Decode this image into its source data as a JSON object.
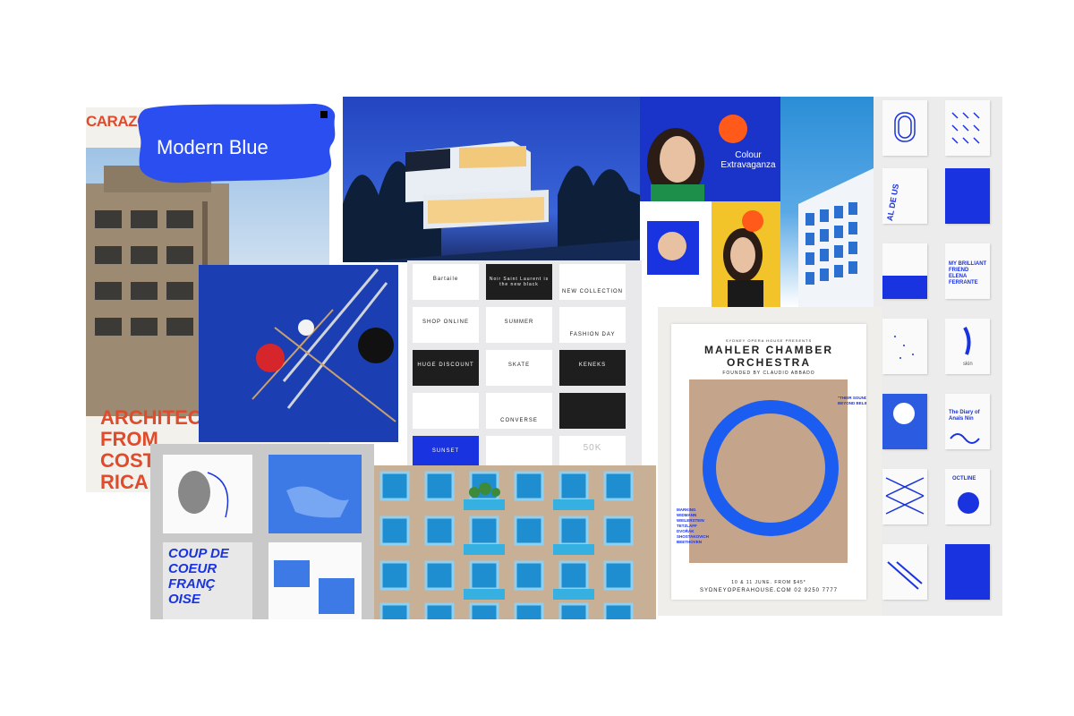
{
  "board": {
    "carazo": {
      "logo": "CARAZO",
      "headline_lines": [
        "ARCHITECTURE",
        "FROM",
        "COSTA",
        "RICA"
      ]
    },
    "brush_label": "Modern Blue",
    "colour_extravaganza": {
      "title_lines": [
        "Colour",
        "Extravaganza"
      ]
    },
    "fashion": {
      "cards": [
        {
          "label": "Bartaile",
          "dark": false
        },
        {
          "label": "Noir Saint Laurent is the new black",
          "dark": true
        },
        {
          "label": "NEW COLLECTION",
          "dark": false
        },
        {
          "label": "SHOP ONLINE",
          "dark": false
        },
        {
          "label": "SUMMER",
          "dark": false
        },
        {
          "label": "FASHION DAY",
          "dark": false
        },
        {
          "label": "HUGE DISCOUNT",
          "dark": true
        },
        {
          "label": "SKATE",
          "dark": false
        },
        {
          "label": "KENEKS",
          "dark": true
        },
        {
          "label": "",
          "dark": false
        },
        {
          "label": "CONVERSE",
          "dark": false
        },
        {
          "label": "",
          "dark": true
        },
        {
          "label": "SUNSET",
          "dark": false
        },
        {
          "label": "",
          "dark": false
        },
        {
          "label": "50K",
          "dark": false
        }
      ]
    },
    "mahler": {
      "presents": "SYDNEY OPERA HOUSE PRESENTS",
      "title_line1": "MAHLER CHAMBER",
      "title_line2": "ORCHESTRA",
      "founded": "FOUNDED BY CLAUDIO ABBADO",
      "quote": "\"THEIR SOUND IS BEYOND BELIEF\"",
      "program": [
        "MARKING",
        "WIDMANN",
        "WEILERSTEIN",
        "TETZLAFF",
        "DVOŘÁK",
        "SHOSTAKOVICH",
        "BEETHOVEN"
      ],
      "date": "10 & 11 JUNE. FROM $45*",
      "site": "SYDNEYOPERAHOUSE.COM   02 9250 7777"
    },
    "books": [
      {
        "title": ""
      },
      {
        "title": ""
      },
      {
        "title": "AL DE US"
      },
      {
        "title": ""
      },
      {
        "title": ""
      },
      {
        "title": "MY BRILLIANT FRIEND ELENA FERRANTE"
      },
      {
        "title": ""
      },
      {
        "title": "skin"
      },
      {
        "title": ""
      },
      {
        "title": "The Diary of Anaïs Nin"
      },
      {
        "title": ""
      },
      {
        "title": "OCTLINE"
      },
      {
        "title": ""
      },
      {
        "title": ""
      }
    ],
    "spread": {
      "cover_lines": [
        "COUP DE",
        "COEUR",
        "FRANÇ",
        "OISE"
      ]
    },
    "colors": {
      "accent_blue": "#1a33e0",
      "brush_blue": "#2b4ef0",
      "orange": "#e24a2c",
      "tan": "#c4a48a"
    }
  }
}
